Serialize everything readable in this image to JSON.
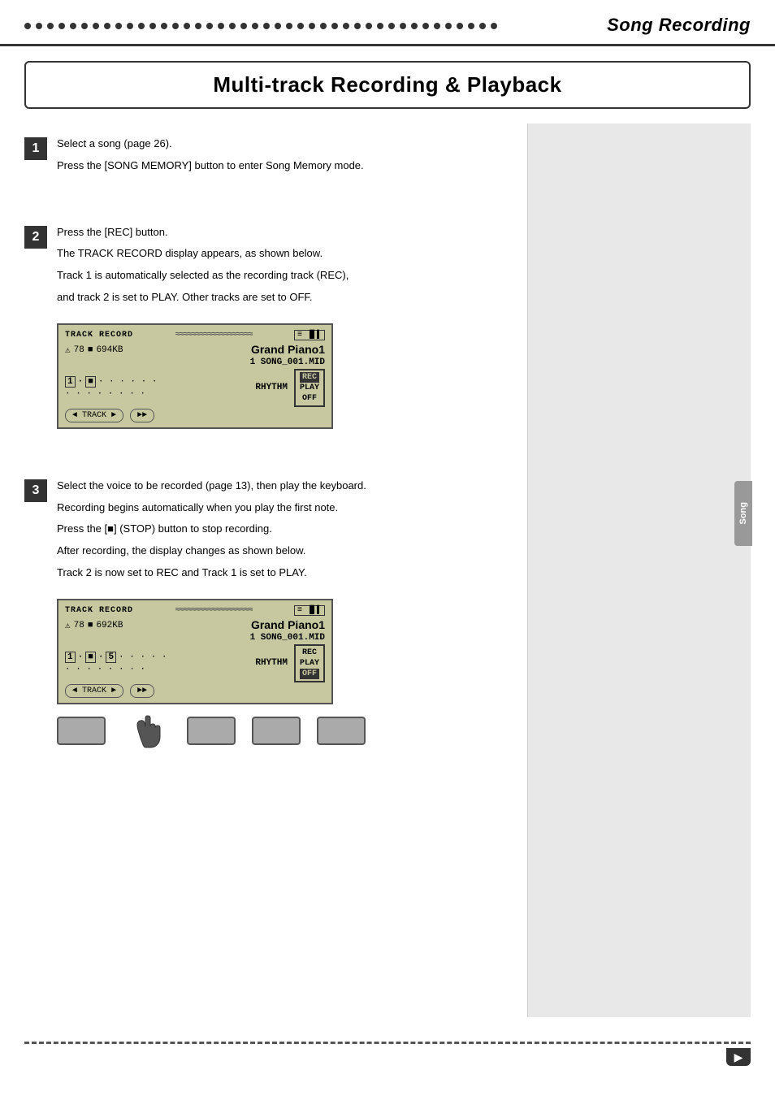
{
  "header": {
    "title": "Song Recording",
    "dots_count": 42
  },
  "section_title": "Multi-track Recording & Playback",
  "steps": [
    {
      "number": "1",
      "paragraphs": [
        "Select a song (page 26).",
        "Press the [SONG MEMORY] button to enter Song Memory mode."
      ]
    },
    {
      "number": "2",
      "paragraphs": [
        "Press the [REC] button.",
        "The TRACK RECORD display appears, as shown below.",
        "Track 1 is automatically selected as the recording track (REC),",
        "and track 2 is set to PLAY. Other tracks are set to OFF."
      ],
      "lcd_1": {
        "track_record_label": "TRACK RECORD",
        "wavy": "≈≈≈≈≈≈≈≈≈≈≈≈≈≈≈≈≈≈≈≈≈≈≈",
        "battery_icon": "≡ ▐▌▌▌",
        "mem_warning": "⚠",
        "mem_value": "78",
        "mem_unit": "■",
        "mem_size": "694KB",
        "voice_name": "Grand Piano1",
        "song_number": "1",
        "song_name": "SONG_001.MID",
        "track_1": "1",
        "track_2": "■",
        "dot_tracks": "· · · · · ·",
        "rhythm_label": "RHYTHM",
        "rec_label": "REC",
        "play_label": "PLAY",
        "off_label": "OFF",
        "track_nav": "◄ TRACK ►",
        "ff_btn": "►►"
      }
    },
    {
      "number": "3",
      "paragraphs": [
        "Select the voice to be recorded (page 13), then play the keyboard.",
        "Recording begins automatically when you play the first note.",
        "Press the [■] (STOP) button to stop recording.",
        "After recording, the display changes as shown below.",
        "Track 2 is now set to REC and Track 1 is set to PLAY."
      ],
      "lcd_2": {
        "track_record_label": "TRACK RECORD",
        "wavy": "≈≈≈≈≈≈≈≈≈≈≈≈≈≈≈≈≈≈≈≈≈≈≈",
        "battery_icon": "≡ ▐▌▌▌",
        "mem_warning": "⚠",
        "mem_value": "78",
        "mem_unit": "■",
        "mem_size": "692KB",
        "voice_name": "Grand Piano1",
        "song_number": "1",
        "song_name": "SONG_001.MID",
        "track_1": "1",
        "track_2": "■",
        "track_3": "5",
        "dot_tracks": "· · · · ·",
        "rhythm_label": "RHYTHM",
        "rec_label": "REC",
        "play_label": "PLAY",
        "off_label": "OFF",
        "off_highlighted": true,
        "track_nav": "◄ TRACK ►",
        "ff_btn": "►►"
      },
      "buttons": [
        {
          "label": "",
          "type": "gray"
        },
        {
          "label": "finger",
          "type": "finger"
        },
        {
          "label": "",
          "type": "gray"
        },
        {
          "label": "",
          "type": "gray"
        },
        {
          "label": "",
          "type": "gray"
        }
      ]
    }
  ],
  "bottom": {
    "corner_arrow": "▶"
  }
}
